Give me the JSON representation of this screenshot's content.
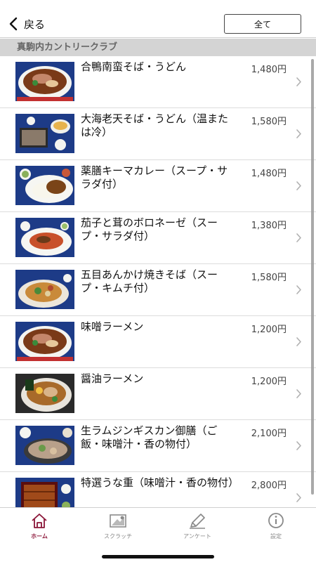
{
  "header": {
    "back_label": "戻る",
    "all_button": "全て"
  },
  "section": {
    "title": "真駒内カントリークラブ"
  },
  "menu": [
    {
      "name": "合鴨南蛮そば・うどん",
      "price": "1,480円",
      "dish": "ramen"
    },
    {
      "name": "大海老天そば・うどん（温または冷）",
      "price": "1,580円",
      "dish": "soba"
    },
    {
      "name": "薬膳キーマカレー（スープ・サラダ付）",
      "price": "1,480円",
      "dish": "curry"
    },
    {
      "name": "茄子と茸のボロネーゼ（スープ・サラダ付）",
      "price": "1,380円",
      "dish": "pasta"
    },
    {
      "name": "五目あんかけ焼きそば（スープ・キムチ付）",
      "price": "1,580円",
      "dish": "yakisoba"
    },
    {
      "name": "味噌ラーメン",
      "price": "1,200円",
      "dish": "ramen"
    },
    {
      "name": "醤油ラーメン",
      "price": "1,200円",
      "dish": "shoyu"
    },
    {
      "name": "生ラムジンギスカン御膳（ご飯・味噌汁・香の物付）",
      "price": "2,100円",
      "dish": "jingisukan"
    },
    {
      "name": "特選うな重（味噌汁・香の物付）",
      "price": "2,800円",
      "dish": "unaju"
    }
  ],
  "tabs": [
    {
      "label": "ホーム",
      "icon": "home-icon",
      "active": true
    },
    {
      "label": "スクラッチ",
      "icon": "scratch-card-icon",
      "active": false
    },
    {
      "label": "アンケート",
      "icon": "pencil-icon",
      "active": false
    },
    {
      "label": "設定",
      "icon": "info-icon",
      "active": false
    }
  ],
  "colors": {
    "accent": "#8b1538",
    "section_bg": "#d4d4d4",
    "photo_bg": "#1d3b87"
  }
}
